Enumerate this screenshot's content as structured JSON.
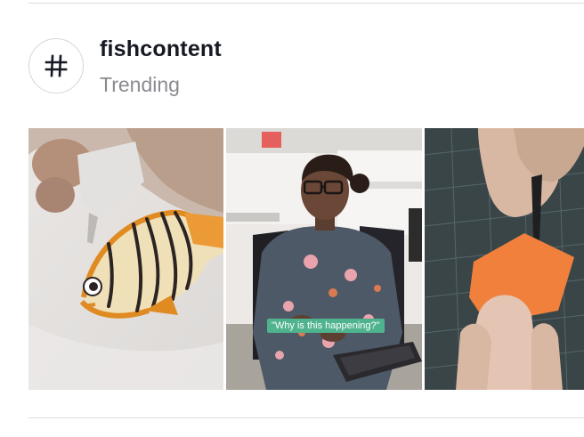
{
  "hashtag": {
    "icon": "hashtag-icon",
    "name": "fishcontent",
    "subtitle": "Trending"
  },
  "videos": [
    {
      "subject": "cookie-icing"
    },
    {
      "subject": "office-woman",
      "caption": "\"Why is this happening?\""
    },
    {
      "subject": "paper-cutting"
    }
  ],
  "colors": {
    "title": "#161823",
    "subtitle": "#8a8b91",
    "divider": "#dcdcdc",
    "caption_bg": "#4fb38e"
  }
}
